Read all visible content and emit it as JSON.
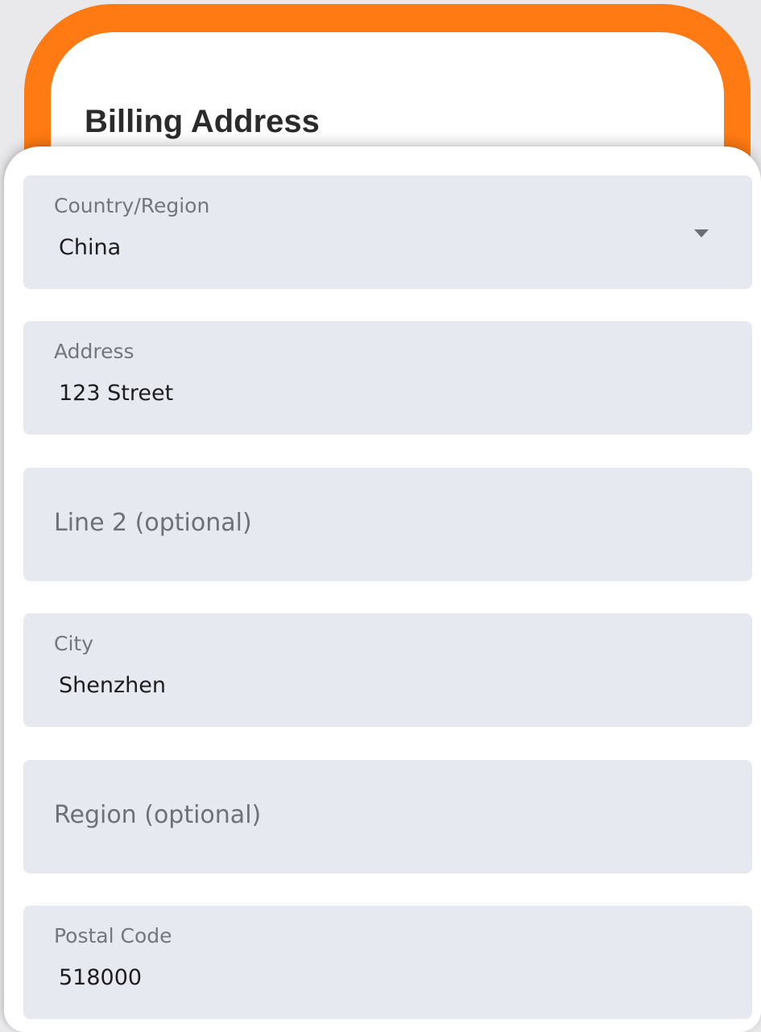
{
  "header": {
    "title": "Billing Address"
  },
  "fields": {
    "country": {
      "label": "Country/Region",
      "value": "China",
      "icon": "chevron-down-icon"
    },
    "address": {
      "label": "Address",
      "value": "123 Street"
    },
    "line2": {
      "placeholder": "Line 2 (optional)"
    },
    "city": {
      "label": "City",
      "value": "Shenzhen"
    },
    "region": {
      "placeholder": "Region (optional)"
    },
    "postal_code": {
      "label": "Postal Code",
      "value": "518000"
    }
  },
  "colors": {
    "accent": "#ff7a12",
    "field_background": "#e7e9f0",
    "card_background": "#ffffff"
  }
}
